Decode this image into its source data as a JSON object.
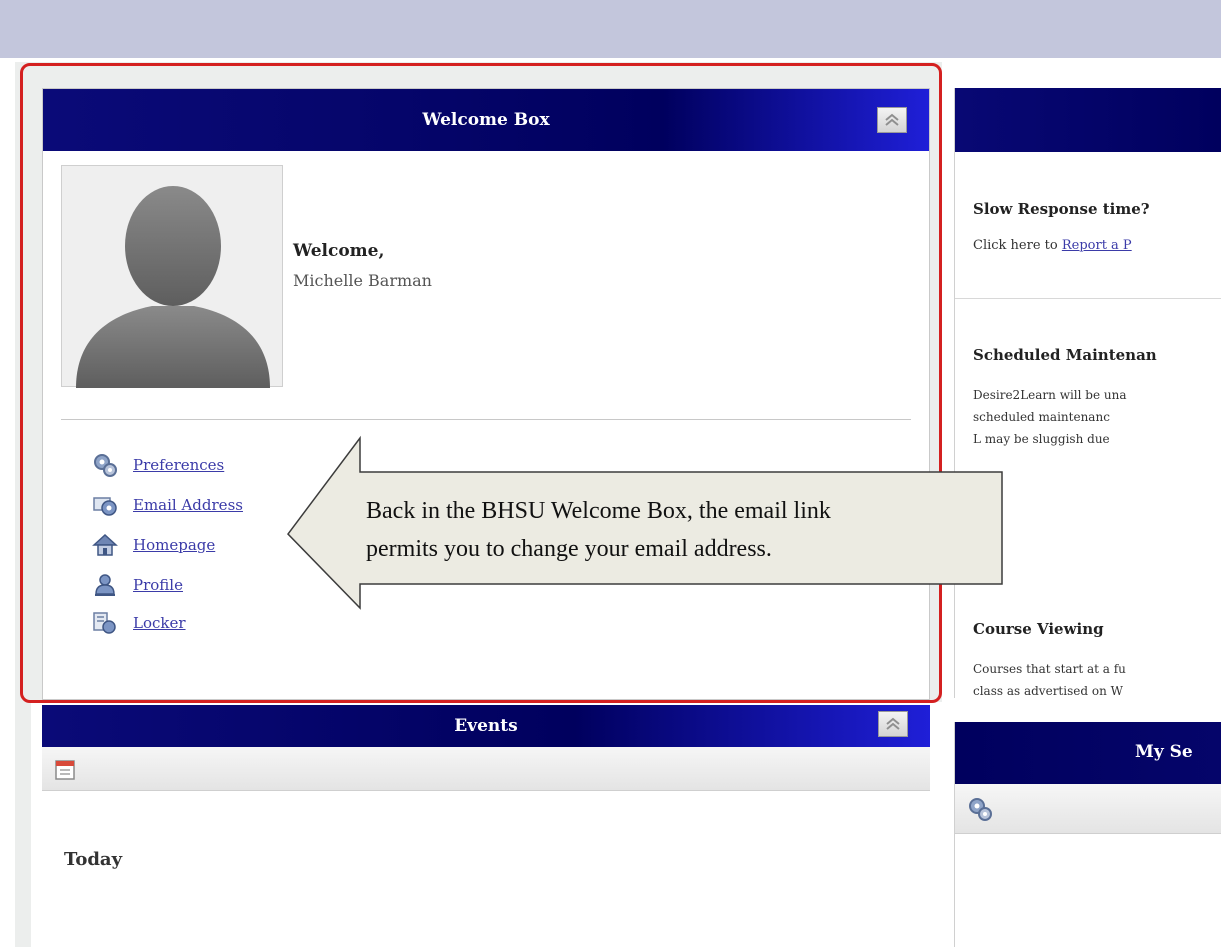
{
  "welcome_box": {
    "title": "Welcome Box",
    "greeting": "Welcome,",
    "user_name": "Michelle Barman",
    "links": [
      {
        "label": "Preferences",
        "icon": "gears-icon"
      },
      {
        "label": "Email Address",
        "icon": "email-icon"
      },
      {
        "label": "Homepage",
        "icon": "house-icon"
      },
      {
        "label": "Profile",
        "icon": "person-icon"
      },
      {
        "label": "Locker",
        "icon": "locker-icon"
      }
    ]
  },
  "callout": {
    "line1": "Back in the BHSU Welcome Box, the email link",
    "line2": "permits you to change your email address."
  },
  "news": {
    "item1_title": "Slow Response time?",
    "item1_prefix": "Click here to ",
    "item1_link": "Report a P",
    "item2_title": "Scheduled Maintenan",
    "item2_line1": "Desire2Learn will be una",
    "item2_line2": "scheduled maintenanc",
    "item2_line3": "L may be sluggish due",
    "item3_title": "Course Viewing",
    "item3_line1": "Courses that start at a fu",
    "item3_line2": "class as advertised on W"
  },
  "events": {
    "title": "Events",
    "today": "Today"
  },
  "my_settings": {
    "title": "My Se"
  },
  "colors": {
    "header_navy": "#00005e",
    "header_highlight": "#1f1fd8",
    "link_blue": "#3b3ba8",
    "highlight_red": "#d42020",
    "topbar": "#c3c6dc"
  }
}
